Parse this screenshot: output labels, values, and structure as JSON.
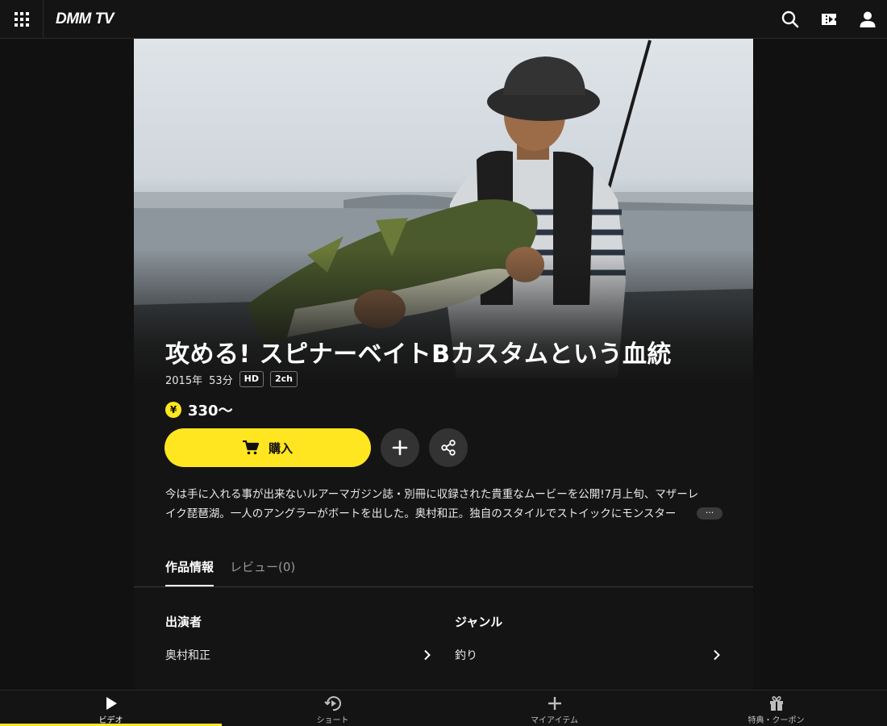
{
  "header": {
    "logo": "DMM TV",
    "menu_icon": "grid-menu-icon",
    "search_icon": "search-icon",
    "ticket_icon": "ticket-icon",
    "account_icon": "user-icon"
  },
  "hero": {
    "title": "攻める! スピナーベイトBカスタムという血統",
    "year": "2015年",
    "duration": "53分",
    "badges": [
      "HD",
      "2ch"
    ],
    "price_symbol": "¥",
    "price": "330〜"
  },
  "actions": {
    "buy_label": "購入",
    "add_icon": "plus-icon",
    "share_icon": "share-icon"
  },
  "description": {
    "line1": "今は手に入れる事が出来ないルアーマガジン誌・別冊に収録された貴重なムービーを公開!7月上旬、マザーレ",
    "line2": "イク琵琶湖。一人のアングラーがボートを出した。奥村和正。独自のスタイルでストイックにモンスター",
    "more_label": "···"
  },
  "tabs": [
    {
      "label": "作品情報",
      "active": true
    },
    {
      "label": "レビュー(0)",
      "active": false
    }
  ],
  "info": {
    "cast_heading": "出演者",
    "cast_value": "奥村和正",
    "genre_heading": "ジャンル",
    "genre_value": "釣り"
  },
  "bottom_nav": [
    {
      "label": "ビデオ",
      "icon": "play-icon",
      "active": true
    },
    {
      "label": "ショート",
      "icon": "short-video-icon",
      "active": false
    },
    {
      "label": "マイアイテム",
      "icon": "plus-icon",
      "active": false
    },
    {
      "label": "特典・クーポン",
      "icon": "gift-icon",
      "active": false
    }
  ],
  "colors": {
    "accent": "#ffe620",
    "background": "#111111",
    "panel": "#141414"
  }
}
